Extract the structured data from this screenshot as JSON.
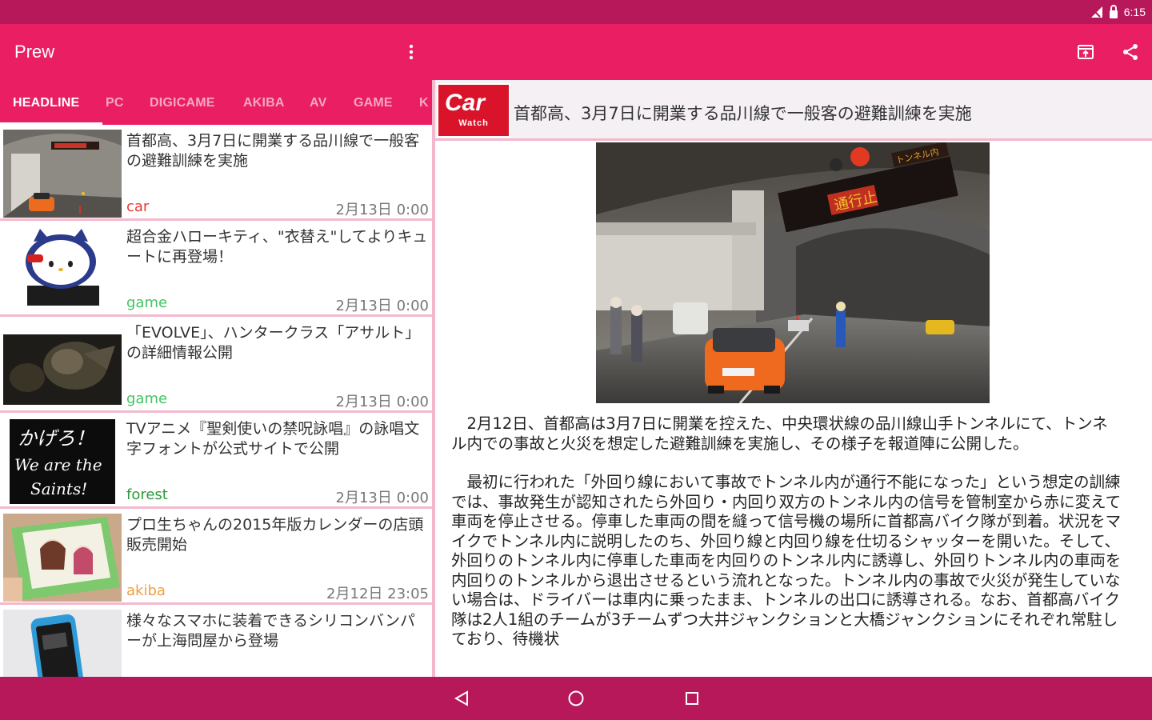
{
  "status": {
    "time": "6:15"
  },
  "app": {
    "title": "Prew"
  },
  "tabs": [
    "HEADLINE",
    "PC",
    "DIGICAME",
    "AKIBA",
    "AV",
    "GAME",
    "K"
  ],
  "colors": {
    "primary": "#e91e63",
    "dark": "#b7185a",
    "divider": "#f4b8cd"
  },
  "list": [
    {
      "title": "首都高、3月7日に開業する品川線で一般客の避難訓練を実施",
      "source": "car",
      "source_color": "#e53935",
      "date": "2月13日 0:00"
    },
    {
      "title": "超合金ハローキティ、\"衣替え\"してよりキュートに再登場！",
      "source": "game",
      "source_color": "#43c463",
      "date": "2月13日 0:00"
    },
    {
      "title": "「EVOLVE」、ハンタークラス「アサルト」の詳細情報公開",
      "source": "game",
      "source_color": "#43c463",
      "date": "2月13日 0:00"
    },
    {
      "title": "TVアニメ『聖剣使いの禁呪詠唱』の詠唱文字フォントが公式サイトで公開",
      "source": "forest",
      "source_color": "#2e9a3c",
      "date": "2月13日 0:00"
    },
    {
      "title": "プロ生ちゃんの2015年版カレンダーの店頭販売開始",
      "source": "akiba",
      "source_color": "#f0a040",
      "date": "2月12日 23:05"
    },
    {
      "title": "様々なスマホに装着できるシリコンバンパーが上海問屋から登場",
      "source": "",
      "source_color": "#777777",
      "date": ""
    }
  ],
  "thumb_text": {
    "forest": [
      "かげろ！",
      "We are the",
      "Saints!"
    ]
  },
  "detail": {
    "logo_main": "Car",
    "logo_sub": "Watch",
    "title": "首都高、3月7日に開業する品川線で一般客の避難訓練を実施",
    "sign_text": "通行止",
    "sign_text2": "トンネル内",
    "paragraphs": [
      "2月12日、首都高は3月7日に開業を控えた、中央環状線の品川線山手トンネルにて、トンネル内での事故と火災を想定した避難訓練を実施し、その様子を報道陣に公開した。",
      "最初に行われた「外回り線において事故でトンネル内が通行不能になった」という想定の訓練では、事故発生が認知されたら外回り・内回り双方のトンネル内の信号を管制室から赤に変えて車両を停止させる。停車した車両の間を縫って信号機の場所に首都高バイク隊が到着。状況をマイクでトンネル内に説明したのち、外回り線と内回り線を仕切るシャッターを開いた。そして、外回りのトンネル内に停車した車両を内回りのトンネル内に誘導し、外回りトンネル内の車両を内回りのトンネルから退出させるという流れとなった。トンネル内の事故で火災が発生していない場合は、ドライバーは車内に乗ったまま、トンネルの出口に誘導される。なお、首都高バイク隊は2人1組のチームが3チームずつ大井ジャンクションと大橋ジャンクションにそれぞれ常駐しており、待機状"
    ]
  }
}
